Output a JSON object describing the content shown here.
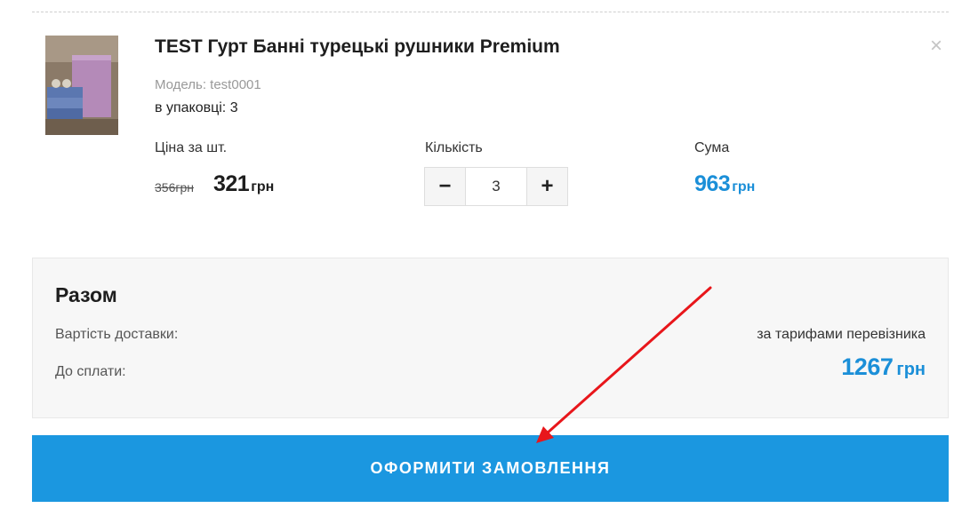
{
  "product": {
    "title": "TEST Гурт Банні турецькі рушники Premium",
    "model": "Модель: test0001",
    "pack": "в упаковці: 3",
    "remove_icon": "close-icon"
  },
  "columns": {
    "price_label": "Ціна за шт.",
    "qty_label": "Кількість",
    "sum_label": "Сума"
  },
  "price": {
    "old": "356грн",
    "new": "321",
    "currency": "грн"
  },
  "quantity": {
    "value": "3",
    "minus": "−",
    "plus": "+"
  },
  "sum": {
    "value": "963",
    "currency": "грн"
  },
  "total": {
    "title": "Разом",
    "delivery_label": "Вартість доставки:",
    "delivery_value": "за тарифами перевізника",
    "pay_label": "До сплати:",
    "pay_value": "1267",
    "pay_currency": "грн"
  },
  "checkout": {
    "label": "ОФОРМИТИ ЗАМОВЛЕННЯ"
  },
  "colors": {
    "accent": "#1b97e0",
    "price_blue": "#1b8fd8",
    "arrow": "#e8161b"
  }
}
